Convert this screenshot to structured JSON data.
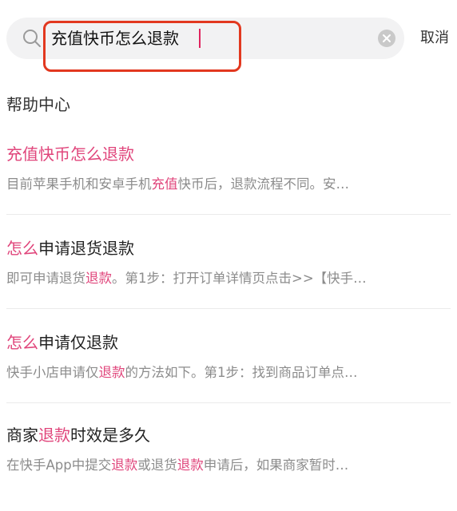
{
  "search": {
    "query": "充值快币怎么退款",
    "cancel_label": "取消"
  },
  "section": {
    "title": "帮助中心"
  },
  "results": [
    {
      "title": [
        {
          "text": "充值快币怎么退款",
          "hl": true
        }
      ],
      "snippet": [
        {
          "text": "目前苹果手机和安卓手机",
          "hl": false
        },
        {
          "text": "充值",
          "hl": true
        },
        {
          "text": "快币后，退款流程不同。安…",
          "hl": false
        }
      ]
    },
    {
      "title": [
        {
          "text": "怎么",
          "hl": true
        },
        {
          "text": "申请退货退款",
          "hl": false
        }
      ],
      "snippet": [
        {
          "text": "即可申请退货",
          "hl": false
        },
        {
          "text": "退款",
          "hl": true
        },
        {
          "text": "。第1步：打开订单详情页点击>>【快手…",
          "hl": false
        }
      ]
    },
    {
      "title": [
        {
          "text": "怎么",
          "hl": true
        },
        {
          "text": "申请仅退款",
          "hl": false
        }
      ],
      "snippet": [
        {
          "text": "快手小店申请仅",
          "hl": false
        },
        {
          "text": "退款",
          "hl": true
        },
        {
          "text": "的方法如下。第1步：找到商品订单点…",
          "hl": false
        }
      ]
    },
    {
      "title": [
        {
          "text": "商家",
          "hl": false
        },
        {
          "text": "退款",
          "hl": true
        },
        {
          "text": "时效是多久",
          "hl": false
        }
      ],
      "snippet": [
        {
          "text": "在快手App中提交",
          "hl": false
        },
        {
          "text": "退款",
          "hl": true
        },
        {
          "text": "或退货",
          "hl": false
        },
        {
          "text": "退款",
          "hl": true
        },
        {
          "text": "申请后，如果商家暂时…",
          "hl": false
        }
      ]
    }
  ],
  "colors": {
    "highlight": "#e0457b",
    "annotation_box": "#e2381f",
    "search_bg": "#f2f2f3"
  },
  "icons": [
    "search-icon",
    "clear-icon"
  ]
}
